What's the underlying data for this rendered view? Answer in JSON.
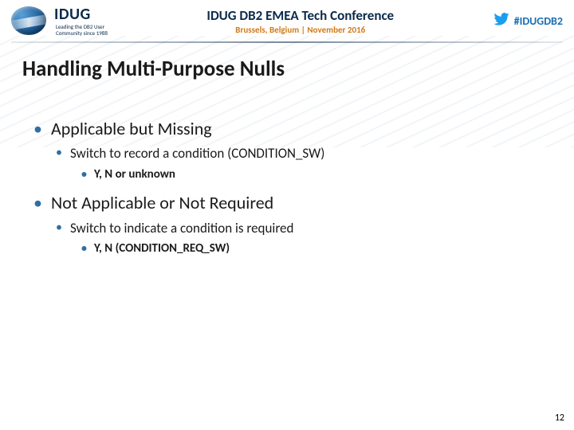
{
  "header": {
    "brand": "IDUG",
    "tagline_line1": "Leading the DB2 User",
    "tagline_line2": "Community since 1988",
    "conference_title": "IDUG DB2 EMEA Tech Conference",
    "conference_sub": "Brussels, Belgium | November 2016",
    "hashtag": "#IDUGDB2"
  },
  "title": "Handling Multi-Purpose Nulls",
  "bullets": [
    {
      "text": "Applicable but Missing",
      "children": [
        {
          "text": "Switch to record a condition (CONDITION_SW)",
          "children": [
            {
              "text": "Y, N or unknown"
            }
          ]
        }
      ]
    },
    {
      "text": "Not Applicable or Not Required",
      "children": [
        {
          "text": "Switch to indicate a condition is required",
          "children": [
            {
              "text": "Y, N (CONDITION_REQ_SW)"
            }
          ]
        }
      ]
    }
  ],
  "page_number": "12"
}
